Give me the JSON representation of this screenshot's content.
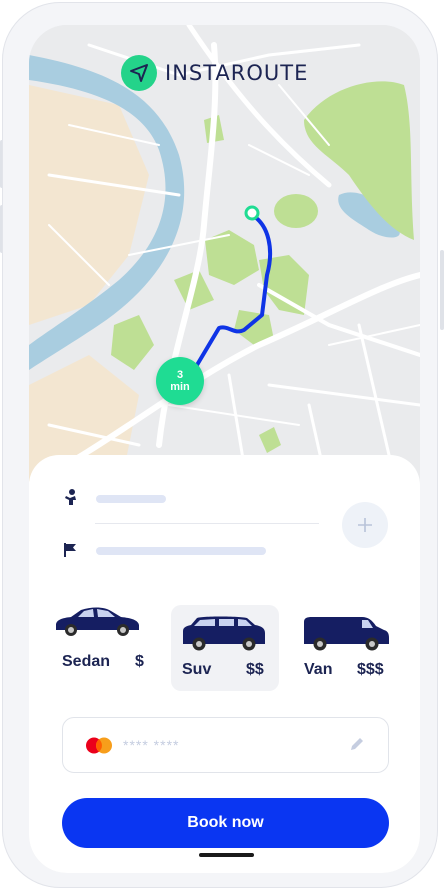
{
  "app": {
    "name": "INSTAROUTE",
    "logo_icon": "navigation-arrow-icon",
    "logo_color": "#24d38a",
    "name_color": "#1c2452"
  },
  "map": {
    "eta_value": "3",
    "eta_unit": "min",
    "route_color": "#0f34e6",
    "origin_marker_color": "#1fdc93"
  },
  "route": {
    "pickup_icon": "passenger-icon",
    "destination_icon": "flag-icon",
    "add_stop_icon": "plus-icon"
  },
  "vehicles": [
    {
      "name": "Sedan",
      "price": "$",
      "icon": "sedan-car-icon",
      "selected": false
    },
    {
      "name": "Suv",
      "price": "$$",
      "icon": "suv-car-icon",
      "selected": true
    },
    {
      "name": "Van",
      "price": "$$$",
      "icon": "van-icon",
      "selected": false
    }
  ],
  "payment": {
    "card_brand_icon": "mastercard-icon",
    "card_number": "**** ****",
    "edit_icon": "pencil-icon"
  },
  "actions": {
    "book_label": "Book now",
    "primary_color": "#0a36f2"
  }
}
